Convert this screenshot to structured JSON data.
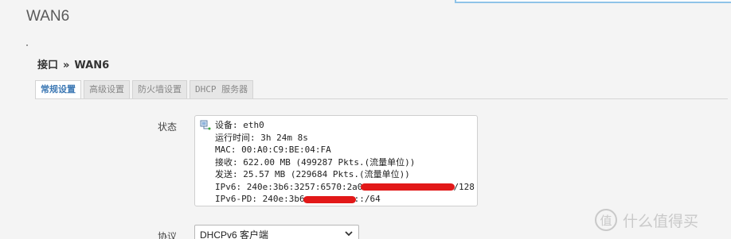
{
  "page": {
    "title": "WAN6"
  },
  "breadcrumb": {
    "parent": "接口",
    "separator": "»",
    "current": "WAN6"
  },
  "tabs": [
    {
      "label": "常规设置",
      "active": true
    },
    {
      "label": "高级设置",
      "active": false
    },
    {
      "label": "防火墙设置",
      "active": false
    },
    {
      "label": "DHCP 服务器",
      "active": false
    }
  ],
  "status": {
    "label": "状态",
    "icon": "network-interface-icon",
    "device": "设备: eth0",
    "uptime": "运行时间: 3h 24m 8s",
    "mac": "MAC: 00:A0:C9:BE:04:FA",
    "rx": "接收: 622.00 MB (499287 Pkts.(流量单位))",
    "tx": "发送: 25.57 MB (229684 Pkts.(流量单位))",
    "ipv6_prefix": "IPv6: 240e:3b6:3257:6570:2a0",
    "ipv6_suffix": "/128",
    "ipv6pd_prefix": "IPv6-PD: 240e:3b6",
    "ipv6pd_suffix": "::/64"
  },
  "protocol": {
    "label": "协议",
    "selected": "DHCPv6 客户端"
  },
  "watermark": {
    "text": "什么值得买",
    "icon": "smzdm-logo-icon"
  },
  "colors": {
    "accent": "#3f7ab5",
    "redaction": "#e21818"
  }
}
